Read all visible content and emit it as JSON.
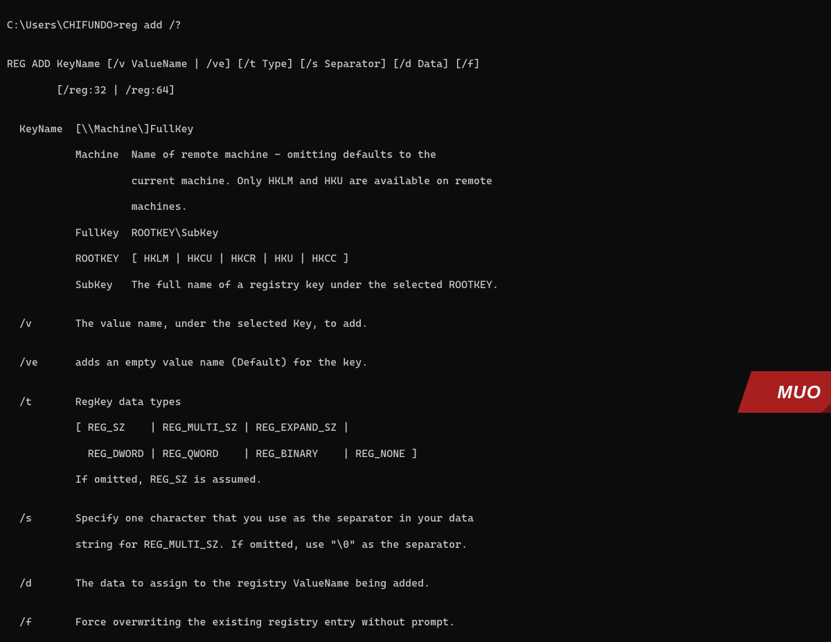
{
  "prompt": "C:\\Users\\CHIFUNDO>reg add /?",
  "blank1": "",
  "syntax1": "REG ADD KeyName [/v ValueName | /ve] [/t Type] [/s Separator] [/d Data] [/f]",
  "syntax2": "        [/reg:32 | /reg:64]",
  "blank2": "",
  "keyname1": "  KeyName  [\\\\Machine\\]FullKey",
  "keyname2": "           Machine  Name of remote machine - omitting defaults to the",
  "keyname3": "                    current machine. Only HKLM and HKU are available on remote",
  "keyname4": "                    machines.",
  "keyname5": "           FullKey  ROOTKEY\\SubKey",
  "keyname6": "           ROOTKEY  [ HKLM | HKCU | HKCR | HKU | HKCC ]",
  "keyname7": "           SubKey   The full name of a registry key under the selected ROOTKEY.",
  "blank3": "",
  "v1": "  /v       The value name, under the selected Key, to add.",
  "blank4": "",
  "ve1": "  /ve      adds an empty value name (Default) for the key.",
  "blank5": "",
  "t1": "  /t       RegKey data types",
  "t2": "           [ REG_SZ    | REG_MULTI_SZ | REG_EXPAND_SZ |",
  "t3": "             REG_DWORD | REG_QWORD    | REG_BINARY    | REG_NONE ]",
  "t4": "           If omitted, REG_SZ is assumed.",
  "blank6": "",
  "s1": "  /s       Specify one character that you use as the separator in your data",
  "s2": "           string for REG_MULTI_SZ. If omitted, use \"\\0\" as the separator.",
  "blank7": "",
  "d1": "  /d       The data to assign to the registry ValueName being added.",
  "blank8": "",
  "f1": "  /f       Force overwriting the existing registry entry without prompt.",
  "logo": "MUO"
}
